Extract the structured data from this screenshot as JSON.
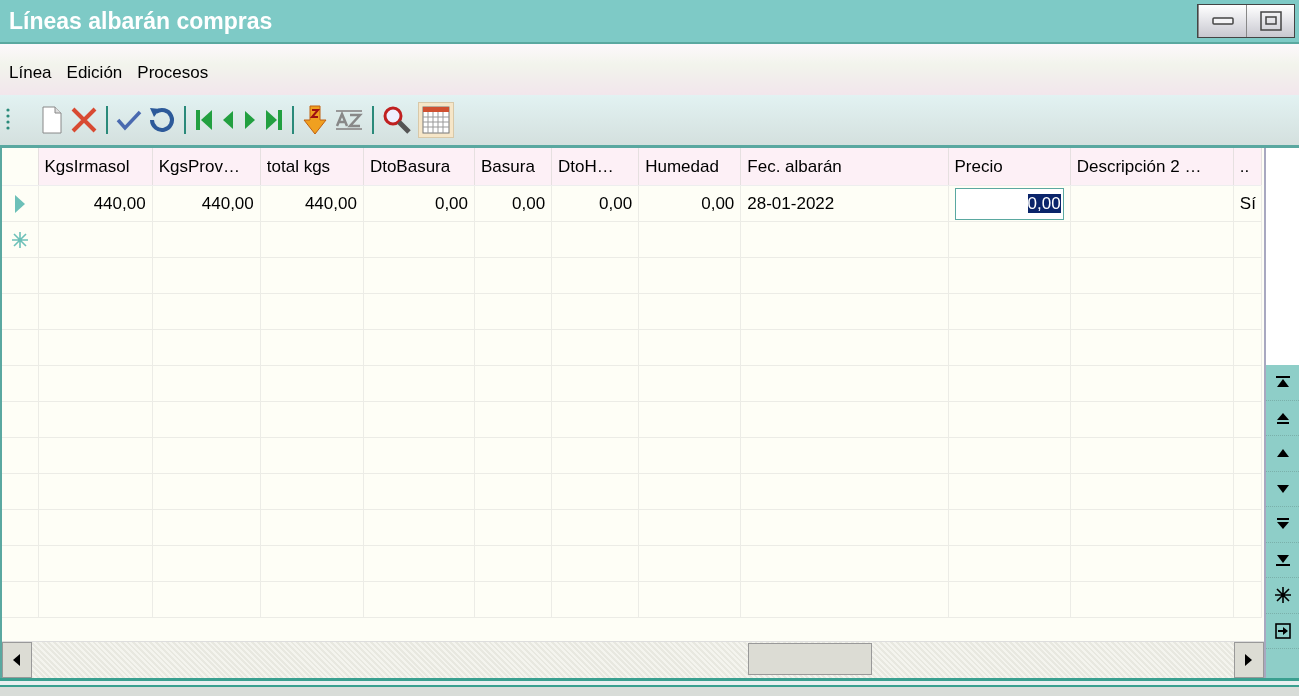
{
  "window": {
    "title": "Líneas albarán compras"
  },
  "menu": [
    {
      "label": "Línea"
    },
    {
      "label": "Edición"
    },
    {
      "label": "Procesos"
    }
  ],
  "table": {
    "columns": [
      "KgsIrmasol",
      "KgsProv…",
      "total kgs",
      "DtoBasura",
      "Basura",
      "DtoH…",
      "Humedad",
      "Fec. albarán",
      "Precio",
      "Descripción 2 …",
      ".."
    ],
    "rows": [
      {
        "kind": "current",
        "cells": [
          {
            "text": "440,00",
            "editing": false
          },
          {
            "text": "440,00",
            "editing": false
          },
          {
            "text": "440,00",
            "editing": false
          },
          {
            "text": "0,00",
            "editing": false
          },
          {
            "text": "0,00",
            "editing": false
          },
          {
            "text": "0,00",
            "editing": false
          },
          {
            "text": "0,00",
            "editing": false
          },
          {
            "text": "28-01-2022",
            "editing": false
          },
          {
            "text": "0,00",
            "editing": true
          },
          {
            "editing": false
          },
          {
            "text": "Sí",
            "editing": false
          }
        ]
      },
      {
        "kind": "new",
        "cells": []
      }
    ]
  }
}
